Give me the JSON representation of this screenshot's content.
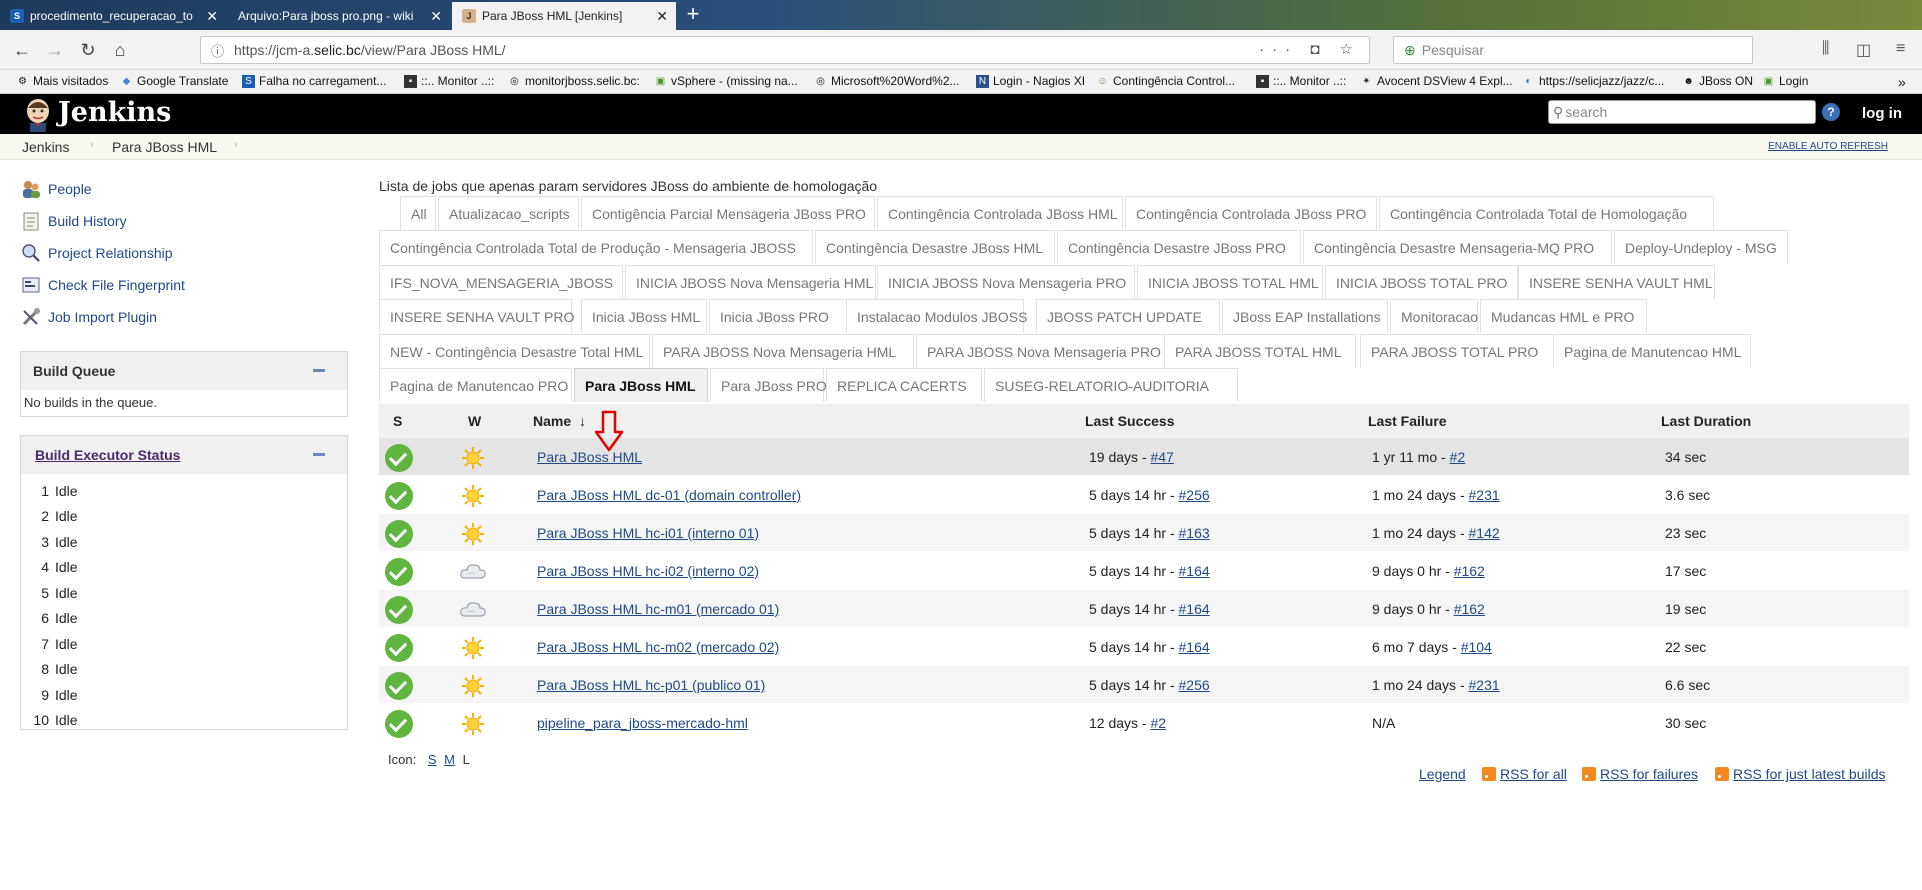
{
  "browser": {
    "tabs": [
      {
        "title": "procedimento_recuperacao_to",
        "icon": "sharepoint-icon"
      },
      {
        "title": "Arquivo:Para jboss pro.png - wiki",
        "icon": ""
      },
      {
        "title": "Para JBoss HML [Jenkins]",
        "icon": "jenkins-icon"
      }
    ],
    "url_prefix": "https://jcm-a.",
    "url_host": "selic.bc",
    "url_path": "/view/Para JBoss HML/",
    "search_placeholder": "Pesquisar",
    "bookmarks": [
      "Mais visitados",
      "Google Translate",
      "Falha no carregament...",
      "::.. Monitor ..::",
      "monitorjboss.selic.bc:",
      "vSphere - (missing na...",
      "Microsoft%20Word%2...",
      "Login - Nagios XI",
      "Contingência Control...",
      "::.. Monitor ..::",
      "Avocent DSView 4 Expl...",
      "https://selicjazz/jazz/c...",
      "JBoss ON",
      "Login"
    ]
  },
  "jenkins": {
    "title": "Jenkins",
    "search_placeholder": "search",
    "login": "log in",
    "breadcrumb": [
      "Jenkins",
      "Para JBoss HML"
    ],
    "auto_refresh": "ENABLE AUTO REFRESH"
  },
  "sidebar": {
    "tasks": [
      {
        "label": "People",
        "icon": "people-icon"
      },
      {
        "label": "Build History",
        "icon": "notepad-icon"
      },
      {
        "label": "Project Relationship",
        "icon": "search-icon"
      },
      {
        "label": "Check File Fingerprint",
        "icon": "fingerprint-icon"
      },
      {
        "label": "Job Import Plugin",
        "icon": "tools-icon"
      }
    ],
    "build_queue": {
      "title": "Build Queue",
      "empty": "No builds in the queue."
    },
    "executors": {
      "title": "Build Executor Status",
      "items": [
        {
          "num": "1",
          "status": "Idle"
        },
        {
          "num": "2",
          "status": "Idle"
        },
        {
          "num": "3",
          "status": "Idle"
        },
        {
          "num": "4",
          "status": "Idle"
        },
        {
          "num": "5",
          "status": "Idle"
        },
        {
          "num": "6",
          "status": "Idle"
        },
        {
          "num": "7",
          "status": "Idle"
        },
        {
          "num": "8",
          "status": "Idle"
        },
        {
          "num": "9",
          "status": "Idle"
        },
        {
          "num": "10",
          "status": "Idle"
        }
      ]
    }
  },
  "main": {
    "description": "Lista de jobs que apenas param servidores JBoss do ambiente de homologação",
    "view_tabs": [
      "All",
      "Atualizacao_scripts",
      "Contigência Parcial Mensageria JBoss PRO",
      "Contingência Controlada JBoss HML",
      "Contingência Controlada JBoss PRO",
      "Contingência Controlada Total de Homologação",
      "Contingência Controlada Total de Produção - Mensageria JBOSS",
      "Contingência Desastre JBoss HML",
      "Contingência Desastre JBoss PRO",
      "Contingência Desastre Mensageria-MQ PRO",
      "Deploy-Undeploy - MSG",
      "IFS_NOVA_MENSAGERIA_JBOSS",
      "INICIA JBOSS Nova Mensageria HML",
      "INICIA JBOSS Nova Mensageria PRO",
      "INICIA JBOSS TOTAL HML",
      "INICIA JBOSS TOTAL PRO",
      "INSERE SENHA VAULT HML",
      "INSERE SENHA VAULT PRO",
      "Inicia JBoss HML",
      "Inicia JBoss PRO",
      "Instalacao Modulos JBOSS",
      "JBOSS PATCH UPDATE",
      "JBoss EAP Installations",
      "Monitoracao",
      "Mudancas HML e PRO",
      "NEW - Contingência Desastre Total HML",
      "PARA JBOSS Nova Mensageria HML",
      "PARA JBOSS Nova Mensageria PRO",
      "PARA JBOSS TOTAL HML",
      "PARA JBOSS TOTAL PRO",
      "Pagina de Manutencao HML",
      "Pagina de Manutencao PRO",
      "Para JBoss HML",
      "Para JBoss PRO",
      "REPLICA CACERTS",
      "SUSEG-RELATORIO-AUDITORIA"
    ],
    "active_tab": "Para JBoss HML",
    "table": {
      "headers": {
        "s": "S",
        "w": "W",
        "name": "Name",
        "sort": "↓",
        "last_success": "Last Success",
        "last_failure": "Last Failure",
        "last_duration": "Last Duration"
      },
      "rows": [
        {
          "name": "Para JBoss HML",
          "weather": "sunny",
          "ls_text": "19 days - ",
          "ls_build": "#47",
          "lf_text": "1 yr 11 mo - ",
          "lf_build": "#2",
          "duration": "34 sec"
        },
        {
          "name": "Para JBoss HML dc-01 (domain controller)",
          "weather": "sunny",
          "ls_text": "5 days 14 hr - ",
          "ls_build": "#256",
          "lf_text": "1 mo 24 days - ",
          "lf_build": "#231",
          "duration": "3.6 sec"
        },
        {
          "name": "Para JBoss HML hc-i01 (interno 01)",
          "weather": "sunny",
          "ls_text": "5 days 14 hr - ",
          "ls_build": "#163",
          "lf_text": "1 mo 24 days - ",
          "lf_build": "#142",
          "duration": "23 sec"
        },
        {
          "name": "Para JBoss HML hc-i02 (interno 02)",
          "weather": "cloudy",
          "ls_text": "5 days 14 hr - ",
          "ls_build": "#164",
          "lf_text": "9 days 0 hr - ",
          "lf_build": "#162",
          "duration": "17 sec"
        },
        {
          "name": "Para JBoss HML hc-m01 (mercado 01)",
          "weather": "cloudy",
          "ls_text": "5 days 14 hr - ",
          "ls_build": "#164",
          "lf_text": "9 days 0 hr - ",
          "lf_build": "#162",
          "duration": "19 sec"
        },
        {
          "name": "Para JBoss HML hc-m02 (mercado 02)",
          "weather": "sunny",
          "ls_text": "5 days 14 hr - ",
          "ls_build": "#164",
          "lf_text": "6 mo 7 days - ",
          "lf_build": "#104",
          "duration": "22 sec"
        },
        {
          "name": "Para JBoss HML hc-p01 (publico 01)",
          "weather": "sunny",
          "ls_text": "5 days 14 hr - ",
          "ls_build": "#256",
          "lf_text": "1 mo 24 days - ",
          "lf_build": "#231",
          "duration": "6.6 sec"
        },
        {
          "name": "pipeline_para_jboss-mercado-hml",
          "weather": "sunny",
          "ls_text": "12 days - ",
          "ls_build": "#2",
          "lf_text": "N/A",
          "lf_build": "",
          "duration": "30 sec"
        }
      ]
    },
    "icon_size": {
      "label": "Icon:",
      "s": "S",
      "m": "M",
      "l": "L"
    },
    "footer": {
      "legend": "Legend",
      "rss_all": "RSS for all",
      "rss_failures": "RSS for failures",
      "rss_latest": "RSS for just latest builds"
    },
    "colors": {
      "success": "#5fb53f",
      "link": "#204a87",
      "annotation_arrow": "#e00000"
    }
  }
}
